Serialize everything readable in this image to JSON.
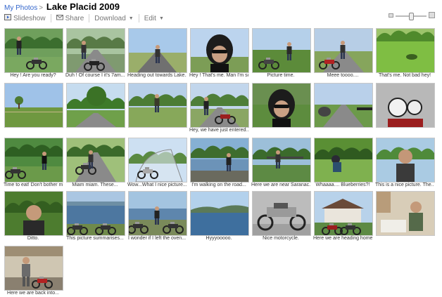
{
  "breadcrumb": {
    "root": "My Photos",
    "separator": ">",
    "album_title": "Lake Placid 2009"
  },
  "toolbar": {
    "slideshow_label": "Slideshow",
    "share_label": "Share",
    "download_label": "Download",
    "edit_label": "Edit",
    "icons": [
      "slideshow-icon",
      "share-icon"
    ]
  },
  "zoom": {
    "level": 0.55
  },
  "accent_color": "#3366cc",
  "photos": [
    {
      "caption": "Hey ! Are you ready?",
      "scene": "man-moto-bushes"
    },
    {
      "caption": "Duh ! Of course I it's 7am...",
      "scene": "road-moto-front"
    },
    {
      "caption": "Heading out towards Lake...",
      "scene": "long-road"
    },
    {
      "caption": "Hey ! That's me. Man I'm so...",
      "scene": "helmet-selfie"
    },
    {
      "caption": "Picture time.",
      "scene": "moto-field"
    },
    {
      "caption": "Meee toooo....",
      "scene": "red-moto-road"
    },
    {
      "caption": "That's me. Not bad hey!",
      "scene": "grass-shadow"
    },
    {
      "caption": "",
      "scene": "pasture-tree"
    },
    {
      "caption": "",
      "scene": "tree-road"
    },
    {
      "caption": "",
      "scene": "man-standing-road"
    },
    {
      "caption": "Hey, we have just entered...",
      "scene": "sign-moto"
    },
    {
      "caption": "",
      "scene": "helmet-selfie-2"
    },
    {
      "caption": "",
      "scene": "mirror-road"
    },
    {
      "caption": "",
      "scene": "gauges"
    },
    {
      "caption": "Time to eat! Don't bother me!",
      "scene": "man-eating"
    },
    {
      "caption": "Miam miam. These...",
      "scene": "road-moto-trees"
    },
    {
      "caption": "Wow...What I nice picture...",
      "scene": "windshield"
    },
    {
      "caption": "I'm walking on the road...",
      "scene": "lake-man"
    },
    {
      "caption": "Here we are near Saranac...",
      "scene": "bridge-man"
    },
    {
      "caption": "Whaaaa.... Blueberries?!",
      "scene": "blueberries"
    },
    {
      "caption": "This is a nice picture. The...",
      "scene": "man-closeup"
    },
    {
      "caption": "Ditto.",
      "scene": "man-portrait-trees"
    },
    {
      "caption": "This picture summarises...",
      "scene": "lake-motos"
    },
    {
      "caption": "I wonder if I left the oven...",
      "scene": "man-motos-lake"
    },
    {
      "caption": "Hyyyooooo.",
      "scene": "lake-wide"
    },
    {
      "caption": "Nice motorcycle.",
      "scene": "moto-closeup"
    },
    {
      "caption": "Here we are heading home...",
      "scene": "house-motos"
    },
    {
      "caption": "",
      "scene": "man-in-room"
    },
    {
      "caption": "Here we are back into...",
      "scene": "man-garage"
    }
  ]
}
